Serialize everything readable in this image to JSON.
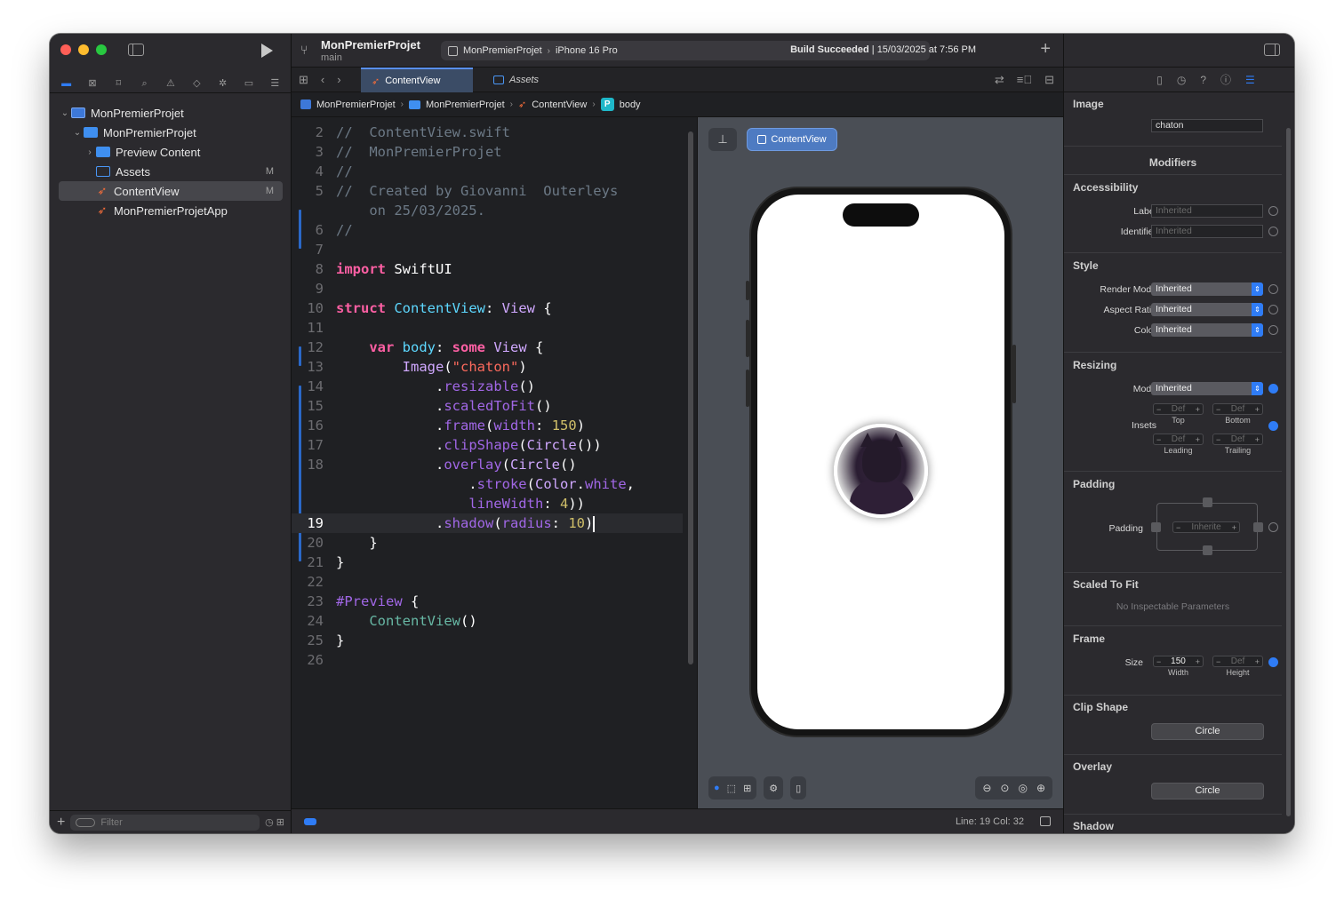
{
  "toolbar": {
    "project_title": "MonPremierProjet",
    "branch": "main",
    "scheme_target": "MonPremierProjet",
    "scheme_device": "iPhone 16 Pro",
    "build_status_strong": "Build Succeeded",
    "build_status_rest": " | 15/03/2025 at 7:56 PM"
  },
  "navigator": {
    "items": [
      {
        "label": "MonPremierProjet",
        "badge": ""
      },
      {
        "label": "MonPremierProjet",
        "badge": ""
      },
      {
        "label": "Preview Content",
        "badge": ""
      },
      {
        "label": "Assets",
        "badge": "M"
      },
      {
        "label": "ContentView",
        "badge": "M"
      },
      {
        "label": "MonPremierProjetApp",
        "badge": ""
      }
    ],
    "filter_placeholder": "Filter"
  },
  "tabs": {
    "active": "ContentView",
    "other": "Assets"
  },
  "jumpbar": [
    "MonPremierProjet",
    "MonPremierProjet",
    "ContentView",
    "body"
  ],
  "editor": {
    "line_numbers": [
      "2",
      "3",
      "4",
      "5",
      "",
      "6",
      "7",
      "8",
      "9",
      "10",
      "11",
      "12",
      "13",
      "14",
      "15",
      "16",
      "17",
      "18",
      "",
      "",
      "19",
      "20",
      "21",
      "22",
      "23",
      "24",
      "25",
      "26"
    ]
  },
  "preview": {
    "chip_label": "ContentView"
  },
  "statusbar": {
    "position": "Line: 19  Col: 32"
  },
  "inspector": {
    "image": {
      "title": "Image",
      "value": "chaton"
    },
    "modifiers_title": "Modifiers",
    "accessibility": {
      "title": "Accessibility",
      "label_lbl": "Label",
      "label_val": "Inherited",
      "identifier_lbl": "Identifier",
      "identifier_val": "Inherited"
    },
    "style": {
      "title": "Style",
      "render_mode_lbl": "Render Mode",
      "render_mode": "Inherited",
      "aspect_lbl": "Aspect Ratio",
      "aspect": "Inherited",
      "color_lbl": "Color",
      "color": "Inherited"
    },
    "resizing": {
      "title": "Resizing",
      "mode_lbl": "Mode",
      "mode": "Inherited",
      "insets_lbl": "Insets",
      "def": "Def",
      "top": "Top",
      "bottom": "Bottom",
      "leading": "Leading",
      "trailing": "Trailing"
    },
    "padding": {
      "title": "Padding",
      "lbl": "Padding",
      "value": "Inherite"
    },
    "scaled": {
      "title": "Scaled To Fit",
      "note": "No Inspectable Parameters"
    },
    "frame": {
      "title": "Frame",
      "size_lbl": "Size",
      "width": "150",
      "height": "Def",
      "width_lbl": "Width",
      "height_lbl": "Height"
    },
    "clip": {
      "title": "Clip Shape",
      "value": "Circle"
    },
    "overlay": {
      "title": "Overlay",
      "value": "Circle"
    },
    "shadow": {
      "title": "Shadow"
    }
  },
  "colors": {
    "accent": "#2f7cf6",
    "keyword": "#fc5fa3",
    "string": "#fc6a5d",
    "comment": "#6c7986"
  }
}
